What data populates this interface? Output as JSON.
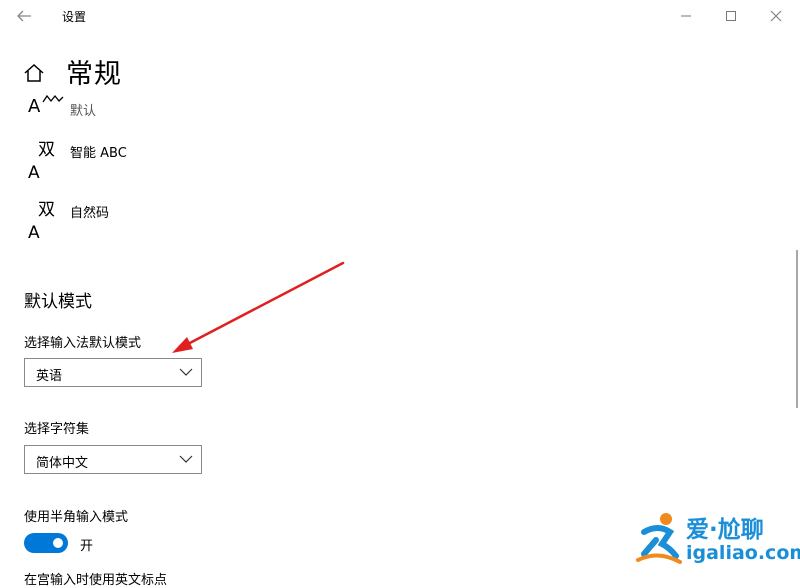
{
  "window": {
    "title": "设置",
    "back_icon": "back-arrow-icon",
    "minimize_icon": "minimize-icon",
    "maximize_icon": "maximize-icon",
    "close_icon": "close-icon"
  },
  "header": {
    "home_icon": "home-icon",
    "title": "常规"
  },
  "ime_list": [
    {
      "label": "默认",
      "icon": "ime-default-icon"
    },
    {
      "label": "智能 ABC",
      "icon": "ime-glyph-icon",
      "glyph_top": "双",
      "glyph_bottom": "A"
    },
    {
      "label": "自然码",
      "icon": "ime-glyph-icon",
      "glyph_top": "双",
      "glyph_bottom": "A"
    }
  ],
  "default_mode": {
    "title": "默认模式",
    "input_mode_label": "选择输入法默认模式",
    "input_mode_value": "英语",
    "charset_label": "选择字符集",
    "charset_value": "简体中文",
    "half_width_label": "使用半角输入模式",
    "half_width_state": "开",
    "half_width_on": true,
    "next_label_cut": "在宫输入时使用英文标点"
  },
  "colors": {
    "accent": "#0078d7",
    "annotation_arrow": "#e02020",
    "watermark_blue": "#1a8fd8",
    "watermark_orange": "#f08a1c"
  },
  "watermark": {
    "brand": "爱·尬聊",
    "domain": "igaliao.com"
  }
}
